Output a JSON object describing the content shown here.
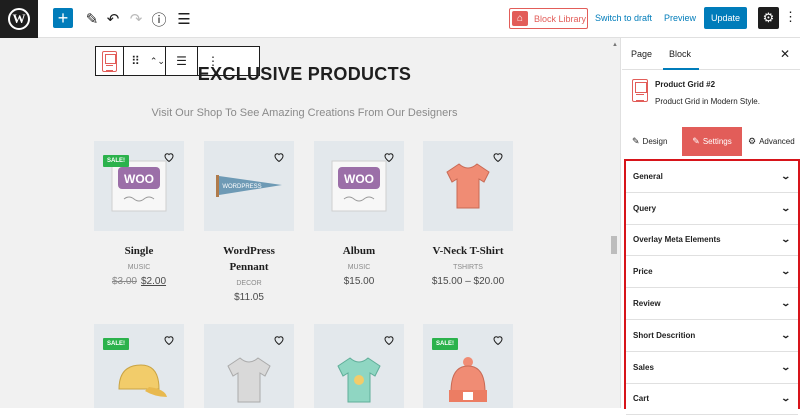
{
  "toolbar": {
    "logo": "W",
    "add": "+",
    "edit": "✎",
    "undo": "↶",
    "redo": "↷",
    "info": "ⓘ",
    "list": "☰",
    "block_library": "Block Library",
    "switch_to_draft": "Switch to draft",
    "preview": "Preview",
    "update": "Update",
    "settings": "⚙",
    "more": "⋮"
  },
  "block_toolbar": {
    "drag": "⠿",
    "move": "⌃⌄",
    "align": "☰",
    "more": "⋮"
  },
  "section": {
    "title": "EXCLUSIVE PRODUCTS",
    "subtitle": "Visit Our Shop To See Amazing Creations From Our Designers"
  },
  "products": [
    {
      "name": "Single",
      "category": "MUSIC",
      "old_price": "$3.00",
      "price": "$2.00",
      "sale": "SALE!",
      "image": "woo-single-icon"
    },
    {
      "name": "WordPress Pennant",
      "category": "DECOR",
      "price": "$11.05",
      "image": "pennant-icon"
    },
    {
      "name": "Album",
      "category": "MUSIC",
      "price": "$15.00",
      "image": "woo-album-icon"
    },
    {
      "name": "V-Neck T-Shirt",
      "category": "TSHIRTS",
      "price": "$15.00 – $20.00",
      "image": "tshirt-icon"
    },
    {
      "sale": "SALE!",
      "image": "cap-icon"
    },
    {
      "image": "tshirt-grey-icon"
    },
    {
      "image": "tshirt-teal-icon"
    },
    {
      "sale": "SALE!",
      "image": "beanie-icon"
    }
  ],
  "colors": {
    "accent": "#e25d59",
    "primary": "#007cba",
    "sale": "#2bb24c",
    "highlight": "#d7141a"
  },
  "sidebar": {
    "tabs": [
      "Page",
      "Block"
    ],
    "close": "✕",
    "block_title": "Product Grid #2",
    "block_desc": "Product Grid in Modern Style.",
    "subtabs": [
      "Design",
      "Settings",
      "Advanced"
    ],
    "panels": [
      "General",
      "Query",
      "Overlay Meta Elements",
      "Price",
      "Review",
      "Short Descrition",
      "Sales",
      "Cart"
    ]
  }
}
